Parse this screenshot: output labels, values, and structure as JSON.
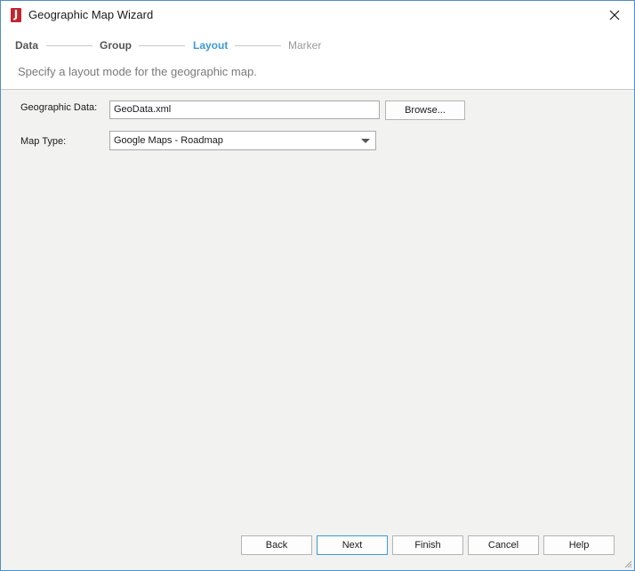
{
  "window": {
    "title": "Geographic Map Wizard",
    "app_icon_letter": "J",
    "close_icon": "close-icon"
  },
  "steps": [
    {
      "label": "Data",
      "state": "done"
    },
    {
      "label": "Group",
      "state": "done"
    },
    {
      "label": "Layout",
      "state": "active"
    },
    {
      "label": "Marker",
      "state": "disabled"
    }
  ],
  "header": {
    "subtitle": "Specify a layout mode for the geographic map."
  },
  "form": {
    "geo_data_label": "Geographic Data:",
    "geo_data_value": "GeoData.xml",
    "browse_label": "Browse...",
    "map_type_label": "Map Type:",
    "map_type_value": "Google Maps - Roadmap"
  },
  "footer": {
    "back": "Back",
    "next": "Next",
    "finish": "Finish",
    "cancel": "Cancel",
    "help": "Help"
  },
  "colors": {
    "accent": "#3a9bd5",
    "window_border": "#4f90c8",
    "app_icon": "#c0262c"
  }
}
